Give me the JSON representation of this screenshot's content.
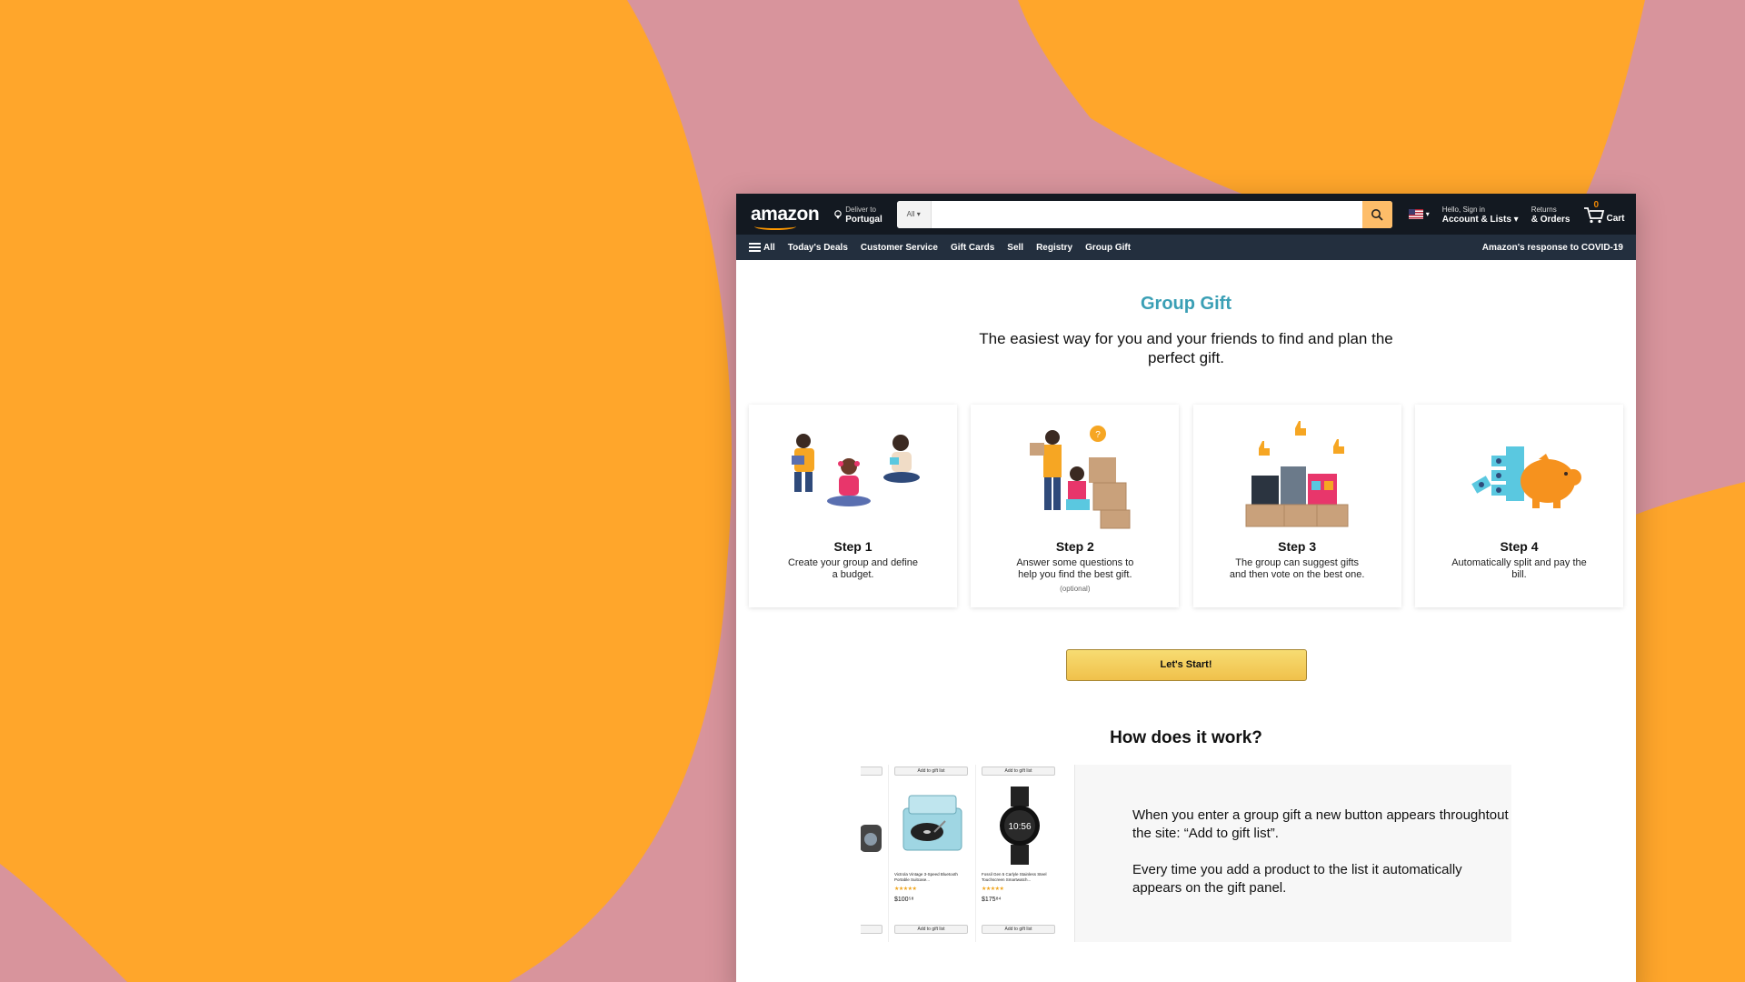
{
  "header": {
    "logo": "amazon",
    "deliver_line1": "Deliver to",
    "deliver_line2": "Portugal",
    "search_category": "All",
    "search_value": "",
    "account_line1": "Hello, Sign in",
    "account_line2": "Account & Lists",
    "returns_line1": "Returns",
    "returns_line2": "& Orders",
    "cart_count": "0",
    "cart_label": "Cart"
  },
  "subnav": {
    "all": "All",
    "items": [
      "Today's Deals",
      "Customer Service",
      "Gift Cards",
      "Sell",
      "Registry",
      "Group Gift"
    ],
    "covid": "Amazon's response to COVID-19"
  },
  "main": {
    "title": "Group Gift",
    "subtitle": "The easiest way for you and your friends to find and plan the perfect gift.",
    "steps": [
      {
        "title": "Step 1",
        "desc": "Create your group and define a budget.",
        "note": ""
      },
      {
        "title": "Step 2",
        "desc": "Answer some questions to help you find the best gift.",
        "note": "(optional)"
      },
      {
        "title": "Step 3",
        "desc": "The group can suggest gifts and then vote on the best one.",
        "note": ""
      },
      {
        "title": "Step 4",
        "desc": "Automatically split and pay the bill.",
        "note": ""
      }
    ],
    "start_button": "Let's Start!",
    "how_title": "How does it work?",
    "how_text_1": "When you enter a group gift a new button appears throughtout the site: “Add to gift list”.",
    "how_text_2": "Every time you add a product to the list it automatically appears on the gift panel.",
    "products": [
      {
        "name": "Victrola Vintage 3-Speed Bluetooth Portable Suitcase...",
        "stars": "★★★★★",
        "price": "$100⁵⁸",
        "button": "Add to gift list"
      },
      {
        "name": "Fossil Gen 5 Carlyle Stainless Steel Touchscreen Smartwatch...",
        "stars": "★★★★★",
        "price": "$175⁸⁴",
        "button": "Add to gift list"
      }
    ],
    "watch_time": "10:56"
  },
  "colors": {
    "bg_orange": "#ffa62b",
    "bg_pink": "#d8949c",
    "nav_dark": "#131921",
    "nav_sub": "#232f3e",
    "accent_teal": "#3a9fb5",
    "search_btn": "#febd69"
  }
}
